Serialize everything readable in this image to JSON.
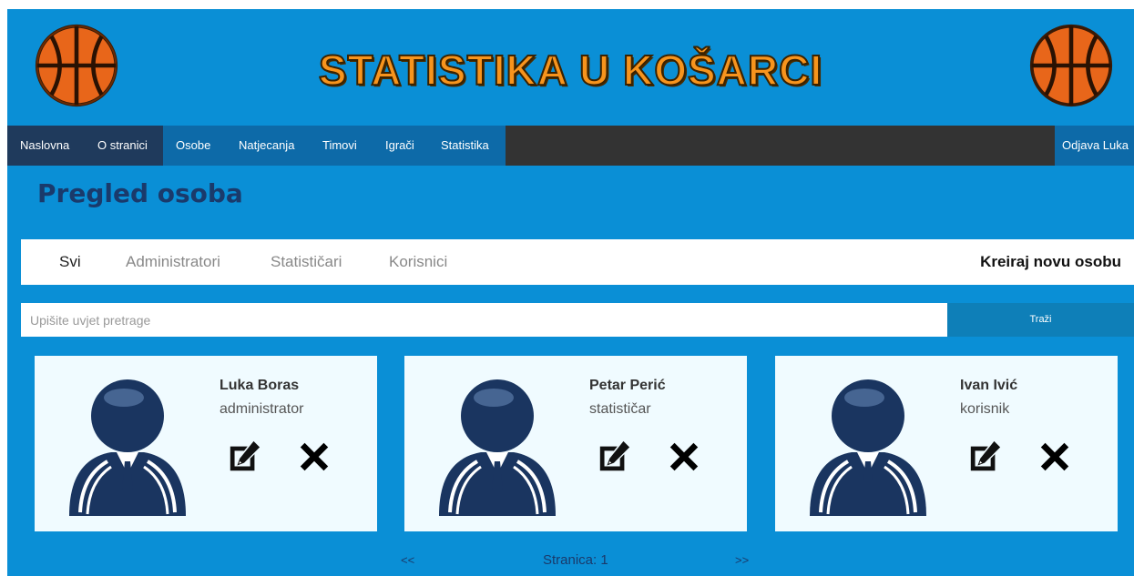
{
  "site": {
    "title": "STATISTIKA U KOŠARCI"
  },
  "nav": {
    "items": [
      "Naslovna",
      "O stranici",
      "Osobe",
      "Natjecanja",
      "Timovi",
      "Igrači",
      "Statistika"
    ],
    "logout": "Odjava Luka"
  },
  "page": {
    "title": "Pregled osoba"
  },
  "tabs": {
    "all": "Svi",
    "admins": "Administratori",
    "statisticians": "Statističari",
    "users": "Korisnici",
    "create": "Kreiraj novu osobu"
  },
  "search": {
    "placeholder": "Upišite uvjet pretrage",
    "value": "",
    "button": "Traži"
  },
  "persons": [
    {
      "name": "Luka Boras",
      "role": "administrator"
    },
    {
      "name": "Petar Perić",
      "role": "statističar"
    },
    {
      "name": "Ivan Ivić",
      "role": "korisnik"
    }
  ],
  "pagination": {
    "prev": "<<",
    "label": "Stranica: 1",
    "next": ">>"
  },
  "colors": {
    "background": "#0a8fd6",
    "navbar": "#333333",
    "title_orange": "#f7941d",
    "heading": "#1a3a6b",
    "card": "#f0fbff",
    "search_button": "#0e7fb8"
  },
  "icons": [
    "basketball-icon",
    "avatar-icon",
    "edit-icon",
    "delete-icon"
  ]
}
